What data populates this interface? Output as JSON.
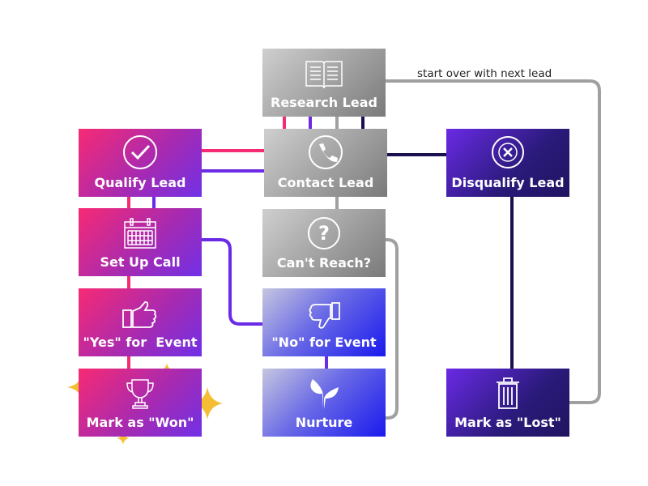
{
  "note": "start over with next lead",
  "nodes": {
    "research": "Research Lead",
    "contact": "Contact Lead",
    "cant_reach": "Can't Reach?",
    "no_event": "\"No\" for Event",
    "nurture": "Nurture",
    "qualify": "Qualify Lead",
    "setup": "Set Up Call",
    "yes_event": "\"Yes\" for  Event",
    "won": "Mark as \"Won\"",
    "disqualify": "Disqualify Lead",
    "lost": "Mark as \"Lost\""
  },
  "colors": {
    "pink": "#f72a74",
    "purple": "#6a2ae6",
    "gray": "#a0a0a0",
    "navy": "#1a1050",
    "star": "#f5bd33"
  }
}
